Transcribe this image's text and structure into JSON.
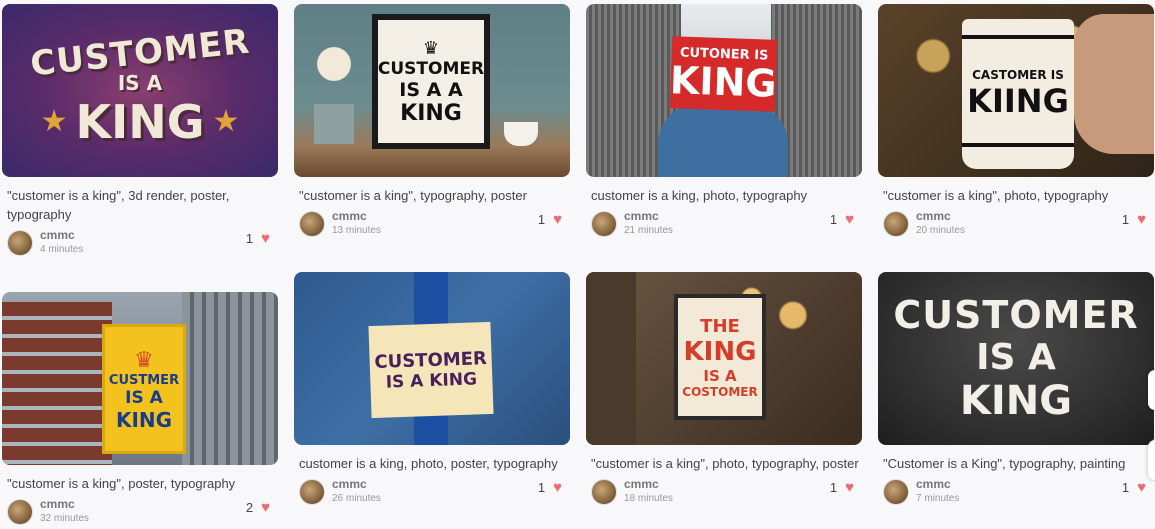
{
  "cards": [
    {
      "caption": "\"customer is a king\", 3d render, poster, typography",
      "user": "cmmc",
      "time": "4 minutes",
      "likes": "1",
      "image_text": [
        "CUSTOMER",
        "IS A",
        "KING"
      ]
    },
    {
      "caption": "\"customer is a king\", typography, poster",
      "user": "cmmc",
      "time": "13 minutes",
      "likes": "1",
      "image_text": [
        "CUSTOMER",
        "IS A A",
        "KING"
      ]
    },
    {
      "caption": "customer is a king, photo, typography",
      "user": "cmmc",
      "time": "21 minutes",
      "likes": "1",
      "image_text": [
        "CUTONER IS",
        "KING"
      ]
    },
    {
      "caption": "\"customer is a king\", photo, typography",
      "user": "cmmc",
      "time": "20 minutes",
      "likes": "1",
      "image_text": [
        "CASTOMER IS",
        "KIING"
      ]
    },
    {
      "caption": "\"customer is a king\", poster, typography",
      "user": "cmmc",
      "time": "32 minutes",
      "likes": "2",
      "image_text": [
        "CUSTMER",
        "IS A",
        "KING"
      ]
    },
    {
      "caption": "customer is a king, photo, poster, typography",
      "user": "cmmc",
      "time": "26 minutes",
      "likes": "1",
      "image_text": [
        "CUSTOMER",
        "IS A KING"
      ]
    },
    {
      "caption": "\"customer is a king\", photo, typography, poster",
      "user": "cmmc",
      "time": "18 minutes",
      "likes": "1",
      "image_text": [
        "THE",
        "KING",
        "IS A",
        "COSTOMER"
      ]
    },
    {
      "caption": "\"Customer is a King\", typography, painting",
      "user": "cmmc",
      "time": "7 minutes",
      "likes": "1",
      "image_text": [
        "CUSTOMER",
        "IS A",
        "KING"
      ]
    }
  ],
  "icons": {
    "like": "heart-icon",
    "avatar": "user-avatar"
  },
  "colors": {
    "heart": "#f06a72",
    "background": "#f8f8fa"
  }
}
